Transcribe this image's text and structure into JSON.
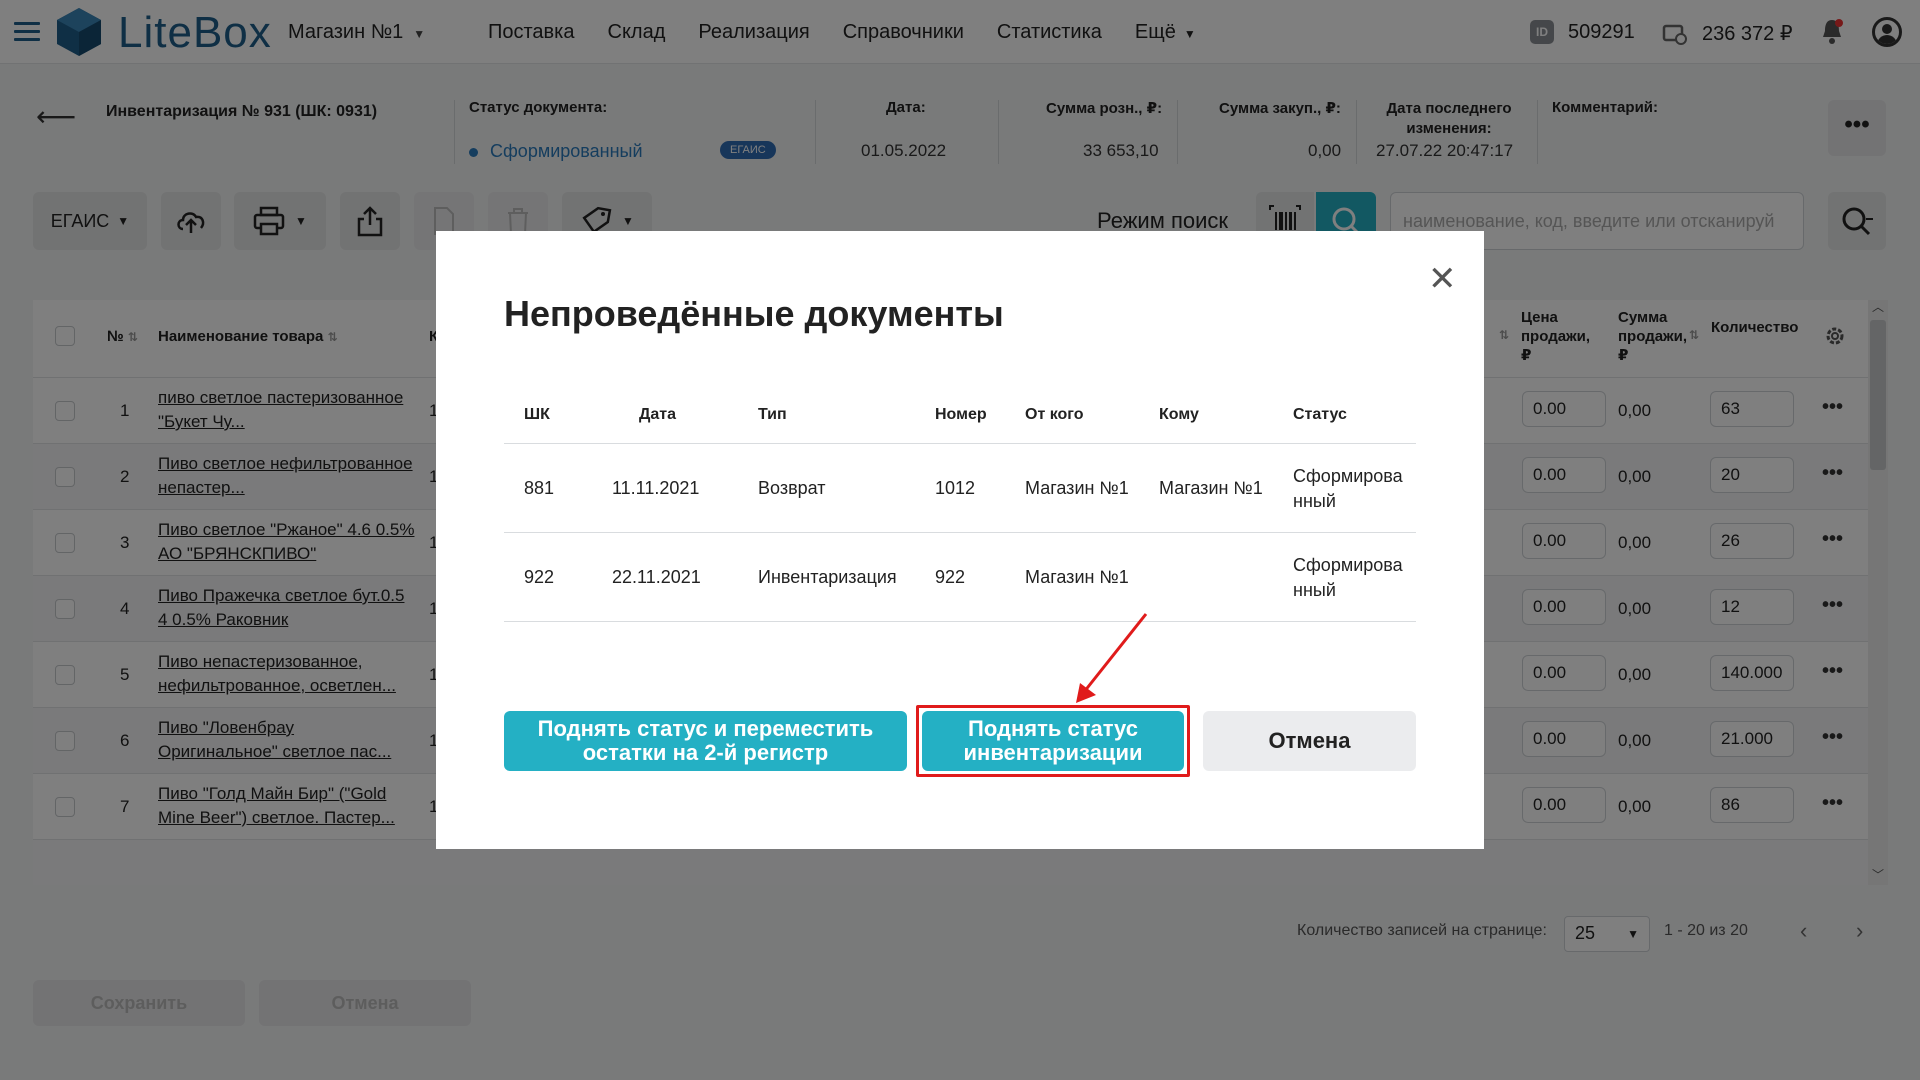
{
  "app": {
    "logo_text": "LiteBox",
    "store": "Магазин №1",
    "nav": [
      "Поставка",
      "Склад",
      "Реализация",
      "Справочники",
      "Статистика",
      "Ещё"
    ],
    "id_badge": "ID",
    "id_number": "509291",
    "balance": "236 372 ₽"
  },
  "document": {
    "title": "Инвентаризация № 931 (ШК: 0931)",
    "status_label": "Статус документа:",
    "status_value": "Сформированный",
    "egais_badge": "ЕГАИС",
    "date_label": "Дата:",
    "date_value": "01.05.2022",
    "retail_sum_label": "Сумма розн., ₽:",
    "retail_sum_value": "33 653,10",
    "purchase_sum_label": "Сумма закуп., ₽:",
    "purchase_sum_value": "0,00",
    "last_change_label": "Дата последнего изменения:",
    "last_change_value": "27.07.22 20:47:17",
    "comment_label": "Комментарий:",
    "more": "•••"
  },
  "toolbar": {
    "egais_label": "ЕГАИС",
    "search_mode": "Режим поиск",
    "search_placeholder": "наименование, код, введите или отсканируй"
  },
  "table": {
    "headers": {
      "num": "№",
      "name": "Наименование товара",
      "k": "К",
      "price": "Цена продажи, ₽",
      "sum": "Сумма продажи, ₽",
      "qty": "Количество"
    },
    "rows": [
      {
        "num": "1",
        "name": "пиво светлое пастеризованное \"Букет Чу...",
        "k": "1",
        "price": "0.00",
        "sum": "0,00",
        "qty": "63"
      },
      {
        "num": "2",
        "name": "Пиво светлое нефильтрованное непастер...",
        "k": "1",
        "price": "0.00",
        "sum": "0,00",
        "qty": "20"
      },
      {
        "num": "3",
        "name": "Пиво светлое \"Ржаное\" 4.6 0.5% АО \"БРЯНСКПИВО\"",
        "k": "1",
        "price": "0.00",
        "sum": "0,00",
        "qty": "26"
      },
      {
        "num": "4",
        "name": "Пиво Пражечка светлое бут.0.5 4 0.5% Раковник",
        "k": "1",
        "price": "0.00",
        "sum": "0,00",
        "qty": "12"
      },
      {
        "num": "5",
        "name": "Пиво непастеризованное, нефильтрованное, осветлен...",
        "k": "1",
        "price": "0.00",
        "sum": "0,00",
        "qty": "140.000"
      },
      {
        "num": "6",
        "name": "Пиво \"Ловенбрау Оригинальное\" светлое пас...",
        "k": "1",
        "price": "0.00",
        "sum": "0,00",
        "qty": "21.000"
      },
      {
        "num": "7",
        "name": "Пиво \"Голд Майн Бир\" (\"Gold Mine Beer\") светлое. Пастер...",
        "k": "1",
        "price": "0.00",
        "sum": "0,00",
        "qty": "86"
      }
    ]
  },
  "pager": {
    "label": "Количество записей на странице:",
    "per_page": "25",
    "range": "1 - 20 из 20"
  },
  "footer": {
    "save": "Сохранить",
    "cancel": "Отмена"
  },
  "modal": {
    "title": "Непроведённые документы",
    "headers": [
      "ШК",
      "Дата",
      "Тип",
      "Номер",
      "От кого",
      "Кому",
      "Статус"
    ],
    "rows": [
      {
        "shk": "881",
        "date": "11.11.2021",
        "type": "Возврат",
        "number": "1012",
        "from": "Магазин №1",
        "to": "Магазин №1",
        "status_1": "Сформирова",
        "status_2": "нный"
      },
      {
        "shk": "922",
        "date": "22.11.2021",
        "type": "Инвентаризация",
        "number": "922",
        "from": "Магазин №1",
        "to": "",
        "status_1": "Сформирова",
        "status_2": "нный"
      }
    ],
    "btn_raise_move_1": "Поднять статус и переместить",
    "btn_raise_move_2": "остатки на 2-й регистр",
    "btn_raise_inv_1": "Поднять статус",
    "btn_raise_inv_2": "инвентаризации",
    "btn_cancel": "Отмена"
  }
}
